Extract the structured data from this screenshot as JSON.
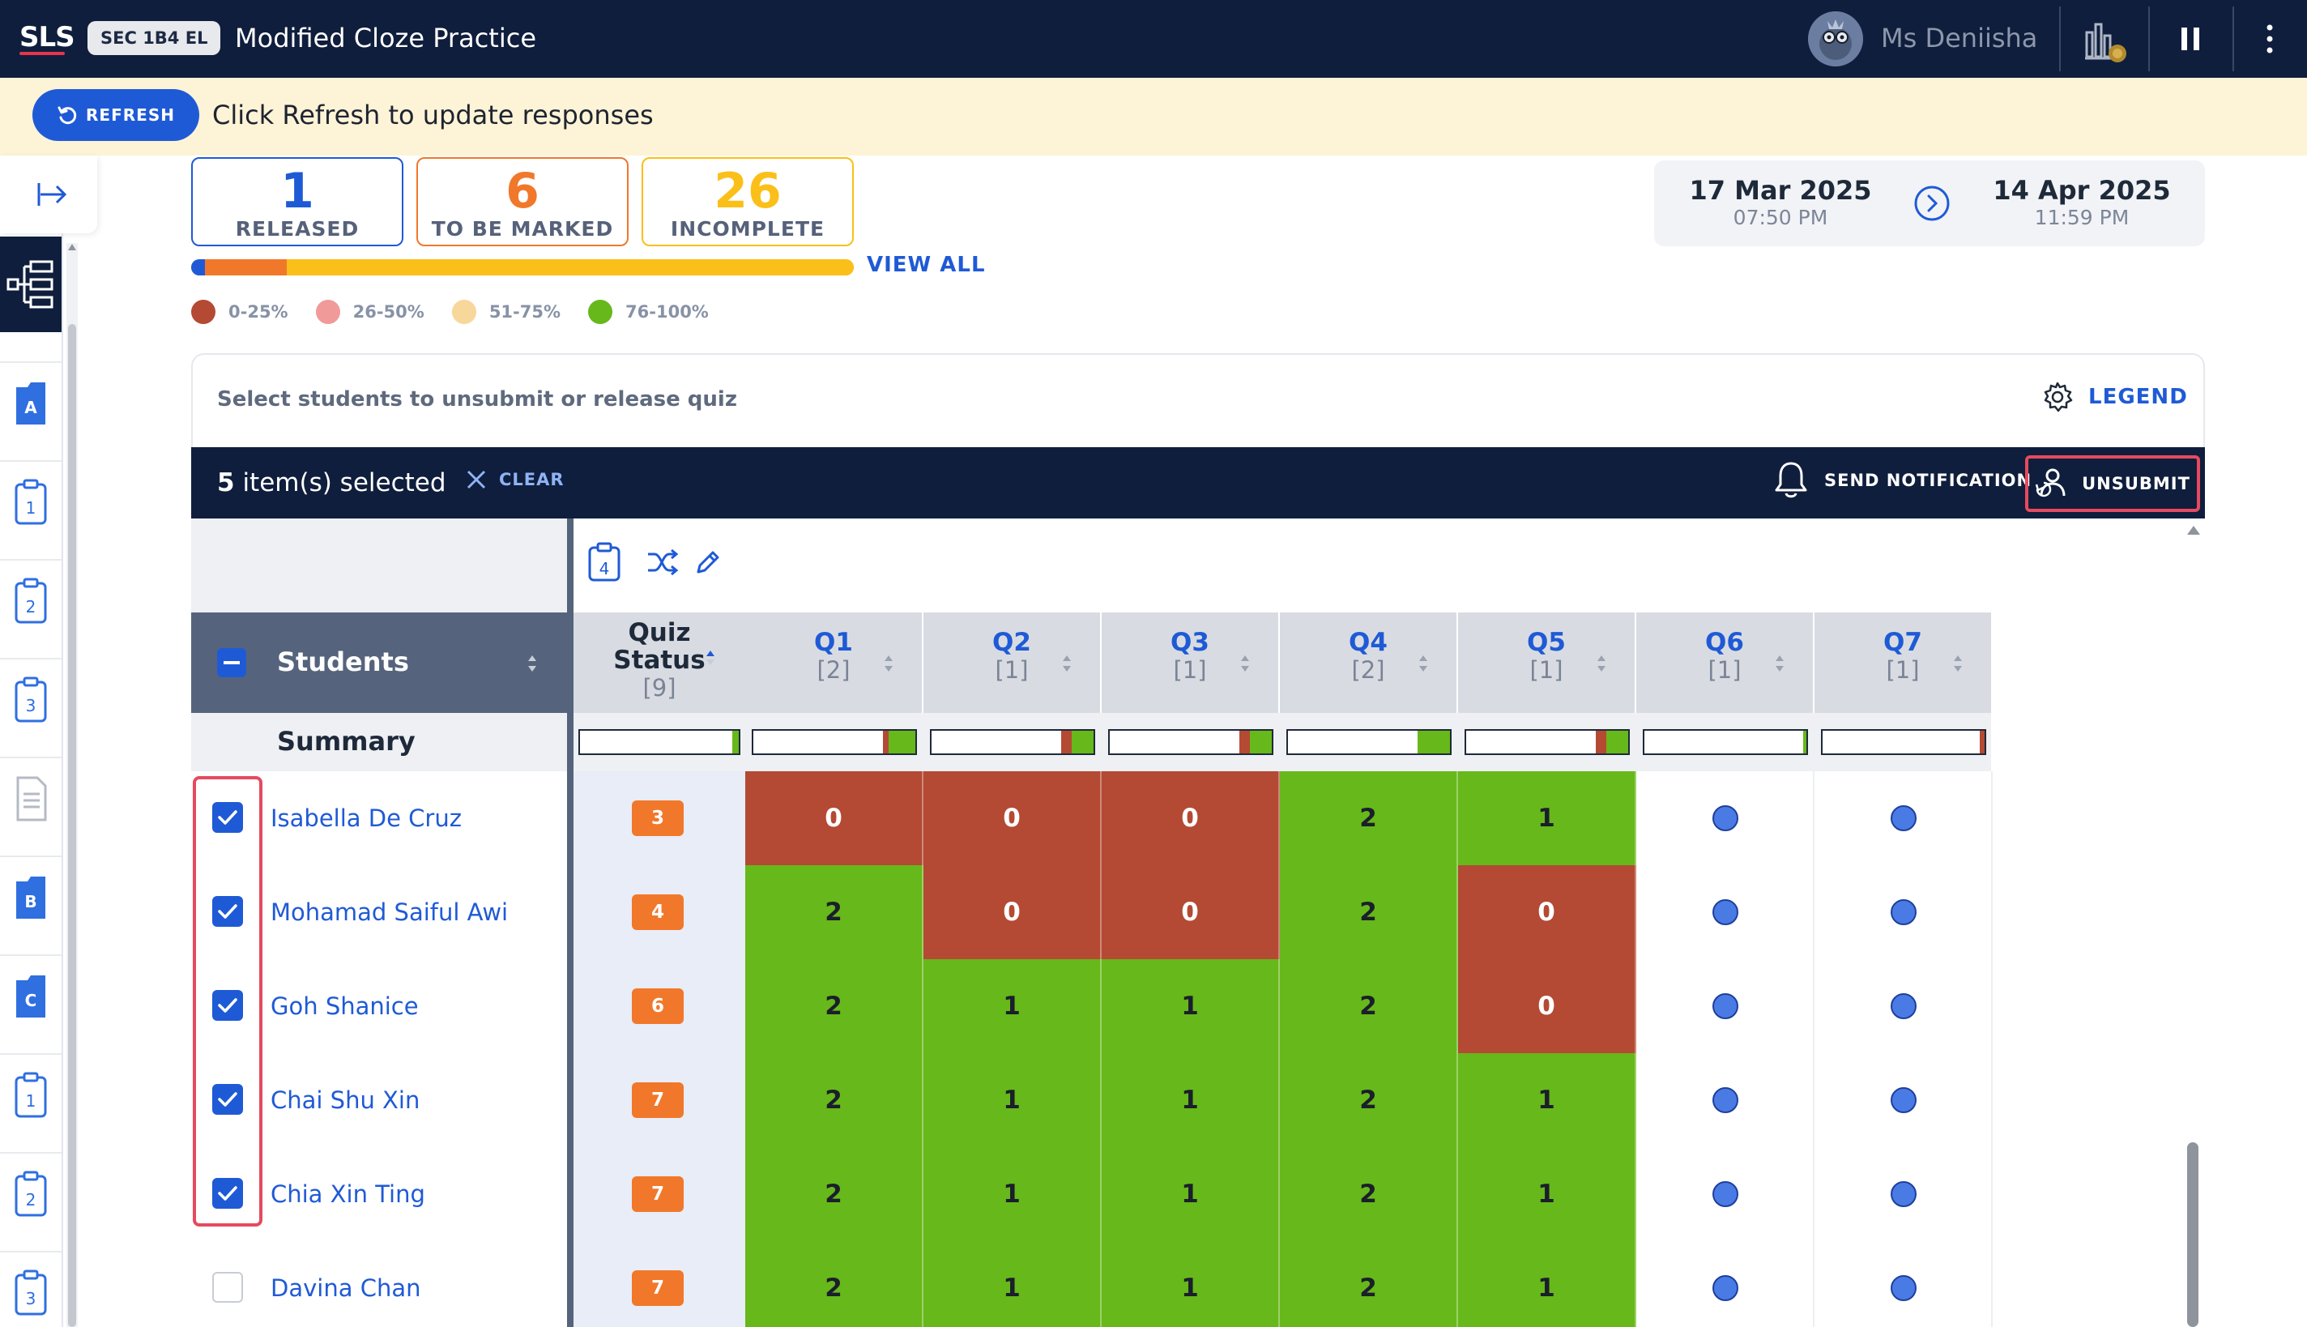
{
  "header": {
    "logo": "SLS",
    "class_badge": "SEC 1B4 EL",
    "title": "Modified Cloze Practice",
    "user_name": "Ms Deniisha"
  },
  "banner": {
    "refresh_label": "REFRESH",
    "message": "Click Refresh to update responses"
  },
  "rail": {
    "items": [
      "A",
      "1",
      "2",
      "3",
      "",
      "B",
      "C",
      "1",
      "2",
      "3"
    ]
  },
  "stats": {
    "released": {
      "value": "1",
      "label": "RELEASED",
      "color": "#1f5ad6"
    },
    "to_be_marked": {
      "value": "6",
      "label": "TO BE MARKED",
      "color": "#f1782a"
    },
    "incomplete": {
      "value": "26",
      "label": "INCOMPLETE",
      "color": "#fbbf19"
    },
    "progress": {
      "released_pct": 2.1,
      "marked_pct": 12.3,
      "incomplete_pct": 85.6
    },
    "view_all": "VIEW ALL"
  },
  "score_legend": [
    {
      "label": "0-25%",
      "color": "#b44a33"
    },
    {
      "label": "26-50%",
      "color": "#f19a9a"
    },
    {
      "label": "51-75%",
      "color": "#f7d79a"
    },
    {
      "label": "76-100%",
      "color": "#67b81a"
    }
  ],
  "dates": {
    "start_date": "17 Mar 2025",
    "start_time": "07:50 PM",
    "end_date": "14 Apr 2025",
    "end_time": "11:59 PM"
  },
  "panel": {
    "hint": "Select students to unsubmit or release quiz",
    "legend_label": "LEGEND"
  },
  "selection": {
    "count": "5",
    "suffix": "item(s) selected",
    "clear_label": "CLEAR",
    "notify_label": "SEND NOTIFICATION",
    "unsubmit_label": "UNSUBMIT"
  },
  "toolbar": {
    "tasks_badge": "4"
  },
  "table": {
    "students_header": "Students",
    "status_header_1": "Quiz",
    "status_header_2": "Status",
    "status_header_max": "[9]",
    "summary_label": "Summary",
    "questions": [
      {
        "label": "Q1",
        "marks": "[2]"
      },
      {
        "label": "Q2",
        "marks": "[1]"
      },
      {
        "label": "Q3",
        "marks": "[1]"
      },
      {
        "label": "Q4",
        "marks": "[2]"
      },
      {
        "label": "Q5",
        "marks": "[1]"
      },
      {
        "label": "Q6",
        "marks": "[1]"
      },
      {
        "label": "Q7",
        "marks": "[1]"
      }
    ],
    "rows": [
      {
        "name": "Isabella De Cruz",
        "selected": true,
        "status": "3",
        "scores": [
          "0",
          "0",
          "0",
          "2",
          "1",
          "",
          ""
        ],
        "colors": [
          "red",
          "red",
          "red",
          "green",
          "green",
          "blank",
          "blank"
        ]
      },
      {
        "name": "Mohamad Saiful Awi",
        "selected": true,
        "status": "4",
        "scores": [
          "2",
          "0",
          "0",
          "2",
          "0",
          "",
          ""
        ],
        "colors": [
          "green",
          "red",
          "red",
          "green",
          "red",
          "blank",
          "blank"
        ]
      },
      {
        "name": "Goh Shanice",
        "selected": true,
        "status": "6",
        "scores": [
          "2",
          "1",
          "1",
          "2",
          "0",
          "",
          ""
        ],
        "colors": [
          "green",
          "green",
          "green",
          "green",
          "red",
          "blank",
          "blank"
        ]
      },
      {
        "name": "Chai Shu Xin",
        "selected": true,
        "status": "7",
        "scores": [
          "2",
          "1",
          "1",
          "2",
          "1",
          "",
          ""
        ],
        "colors": [
          "green",
          "green",
          "green",
          "green",
          "green",
          "blank",
          "blank"
        ]
      },
      {
        "name": "Chia Xin Ting",
        "selected": true,
        "status": "7",
        "scores": [
          "2",
          "1",
          "1",
          "2",
          "1",
          "",
          ""
        ],
        "colors": [
          "green",
          "green",
          "green",
          "green",
          "green",
          "blank",
          "blank"
        ]
      },
      {
        "name": "Davina Chan",
        "selected": false,
        "status": "7",
        "scores": [
          "2",
          "1",
          "1",
          "2",
          "1",
          "",
          ""
        ],
        "colors": [
          "green",
          "green",
          "green",
          "green",
          "green",
          "blank",
          "blank"
        ]
      }
    ]
  }
}
